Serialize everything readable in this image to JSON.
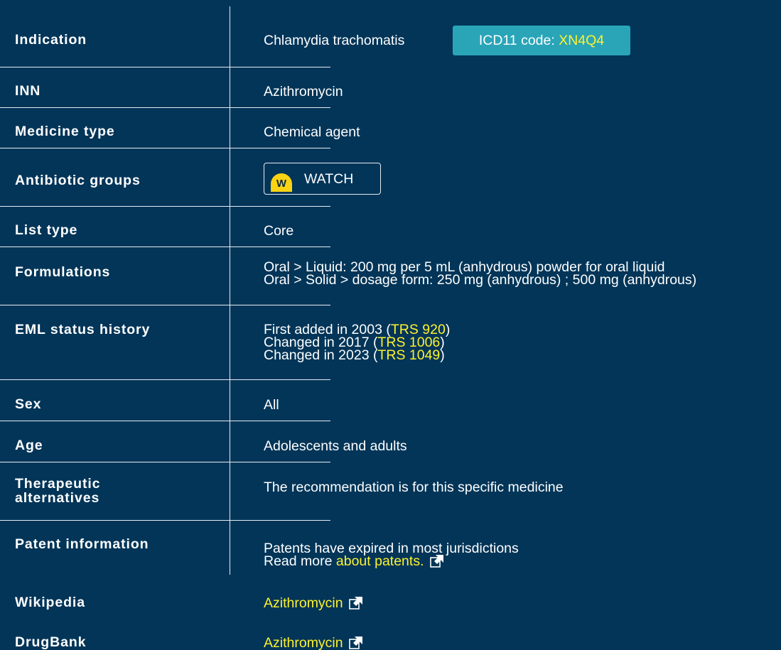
{
  "rows": {
    "indication": {
      "label": "Indication",
      "value": "Chlamydia trachomatis"
    },
    "icd": {
      "prefix": "ICD11 code: ",
      "code": "XN4Q4"
    },
    "inn": {
      "label": "INN",
      "value": "Azithromycin"
    },
    "medicine_type": {
      "label": "Medicine type",
      "value": "Chemical agent"
    },
    "antibiotic_groups": {
      "label": "Antibiotic groups",
      "badge_letter": "W",
      "badge_text": "WATCH"
    },
    "list_type": {
      "label": "List type",
      "value": "Core"
    },
    "formulations": {
      "label": "Formulations",
      "lines": [
        "Oral > Liquid: 200 mg per 5 mL (anhydrous) powder for oral liquid",
        "Oral > Solid > dosage form: 250 mg (anhydrous) ; 500 mg (anhydrous)"
      ]
    },
    "eml_status_history": {
      "label": "EML status history",
      "entries": [
        {
          "prefix": "First added in 2003 (",
          "link": "TRS 920",
          "suffix": ")"
        },
        {
          "prefix": "Changed in 2017 (",
          "link": "TRS 1006",
          "suffix": ")"
        },
        {
          "prefix": "Changed in 2023 (",
          "link": "TRS 1049",
          "suffix": ")"
        }
      ]
    },
    "sex": {
      "label": "Sex",
      "value": "All"
    },
    "age": {
      "label": "Age",
      "value": "Adolescents and adults"
    },
    "therapeutic_alternatives": {
      "label_line1": "Therapeutic",
      "label_line2": "alternatives",
      "value": "The recommendation is for this specific medicine"
    },
    "patent_information": {
      "label": "Patent information",
      "line1": "Patents have expired in most jurisdictions",
      "line2_prefix": "Read more ",
      "line2_link": "about patents."
    },
    "wikipedia": {
      "label": "Wikipedia",
      "link": "Azithromycin"
    },
    "drugbank": {
      "label": "DrugBank",
      "link": "Azithromycin"
    }
  },
  "icons": {
    "external_link": "external-link-icon"
  },
  "colors": {
    "background": "#023558",
    "link": "#fef22e",
    "icd_badge": "#2aa5b8",
    "watch_dot": "#fad313"
  }
}
